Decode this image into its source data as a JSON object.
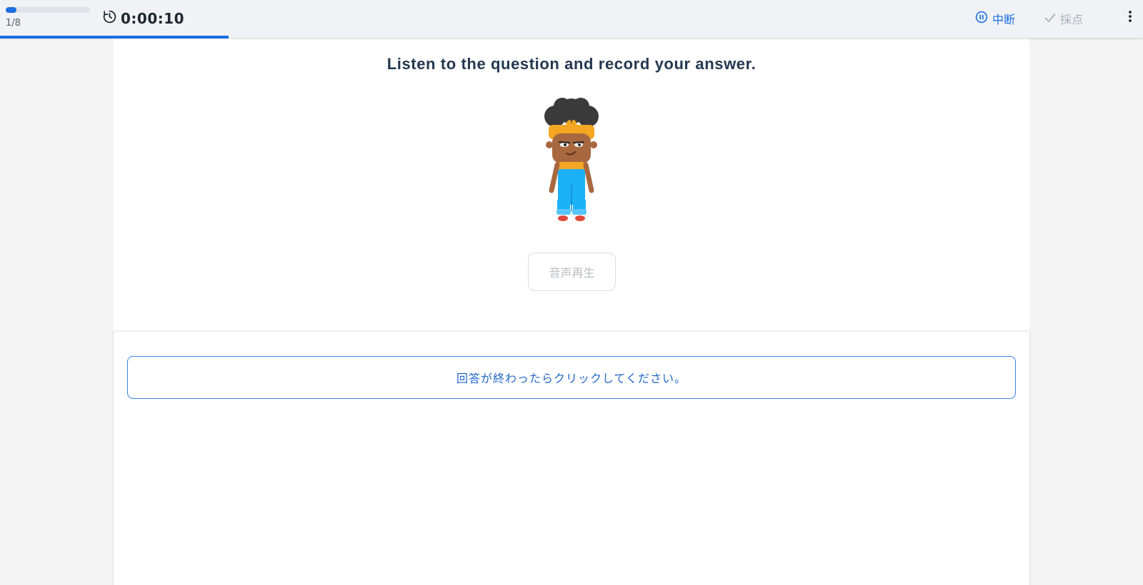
{
  "header": {
    "question_counter": "1/8",
    "question_progress_fraction": 0.125,
    "overall_progress_fraction": 0.2,
    "timer": "0:00:10",
    "pause_label": "中断",
    "grade_label": "採点",
    "icons": {
      "timer": "stopwatch-icon",
      "pause": "pause-circle-icon",
      "grade": "checkmark-icon",
      "more": "more-vertical-icon"
    },
    "accent_color": "#1a6fe0"
  },
  "question": {
    "prompt": "Listen to the question and record your answer.",
    "character": "character-illustration",
    "play_audio_label": "音声再生"
  },
  "answer": {
    "done_label": "回答が終わったらクリックしてください。"
  }
}
